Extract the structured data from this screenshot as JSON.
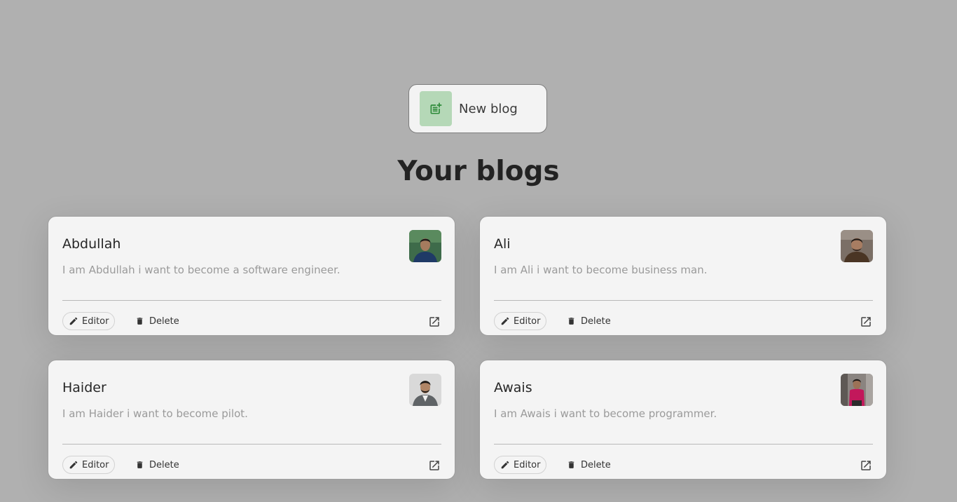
{
  "new_blog": {
    "label": "New blog",
    "icon": "post-add-icon"
  },
  "heading": "Your blogs",
  "blogs": [
    {
      "name": "Abdullah",
      "description": "I am Abdullah i want to become a software engineer.",
      "editor_label": "Editor",
      "delete_label": "Delete",
      "avatar_colors": {
        "bg": "#3e6b4a",
        "shirt": "#1f3a66",
        "skin": "#a57b5e",
        "hair": "#1e1a18"
      }
    },
    {
      "name": "Ali",
      "description": "I am Ali i want to become business man.",
      "editor_label": "Editor",
      "delete_label": "Delete",
      "avatar_colors": {
        "bg": "#7b6f66",
        "shirt": "#4a3524",
        "skin": "#a87d62",
        "hair": "#221b17"
      }
    },
    {
      "name": "Haider",
      "description": "I am Haider i want to become pilot.",
      "editor_label": "Editor",
      "delete_label": "Delete",
      "avatar_colors": {
        "bg": "#d9d9d9",
        "shirt": "#5f6366",
        "skin": "#b08566",
        "hair": "#1c1917"
      }
    },
    {
      "name": "Awais",
      "description": "I am Awais i want to become programmer.",
      "editor_label": "Editor",
      "delete_label": "Delete",
      "avatar_colors": {
        "bg": "#8a8480",
        "shirt": "#c2185b",
        "skin": "#9c7257",
        "hair": "#1f1a17"
      }
    }
  ],
  "colors": {
    "page_bg": "#b0b0b0",
    "card_bg": "#f4f4f4",
    "new_blog_icon_bg": "#b5d8b7",
    "new_blog_icon_fg": "#2e8b3a",
    "muted_text": "#9a9a9a"
  }
}
